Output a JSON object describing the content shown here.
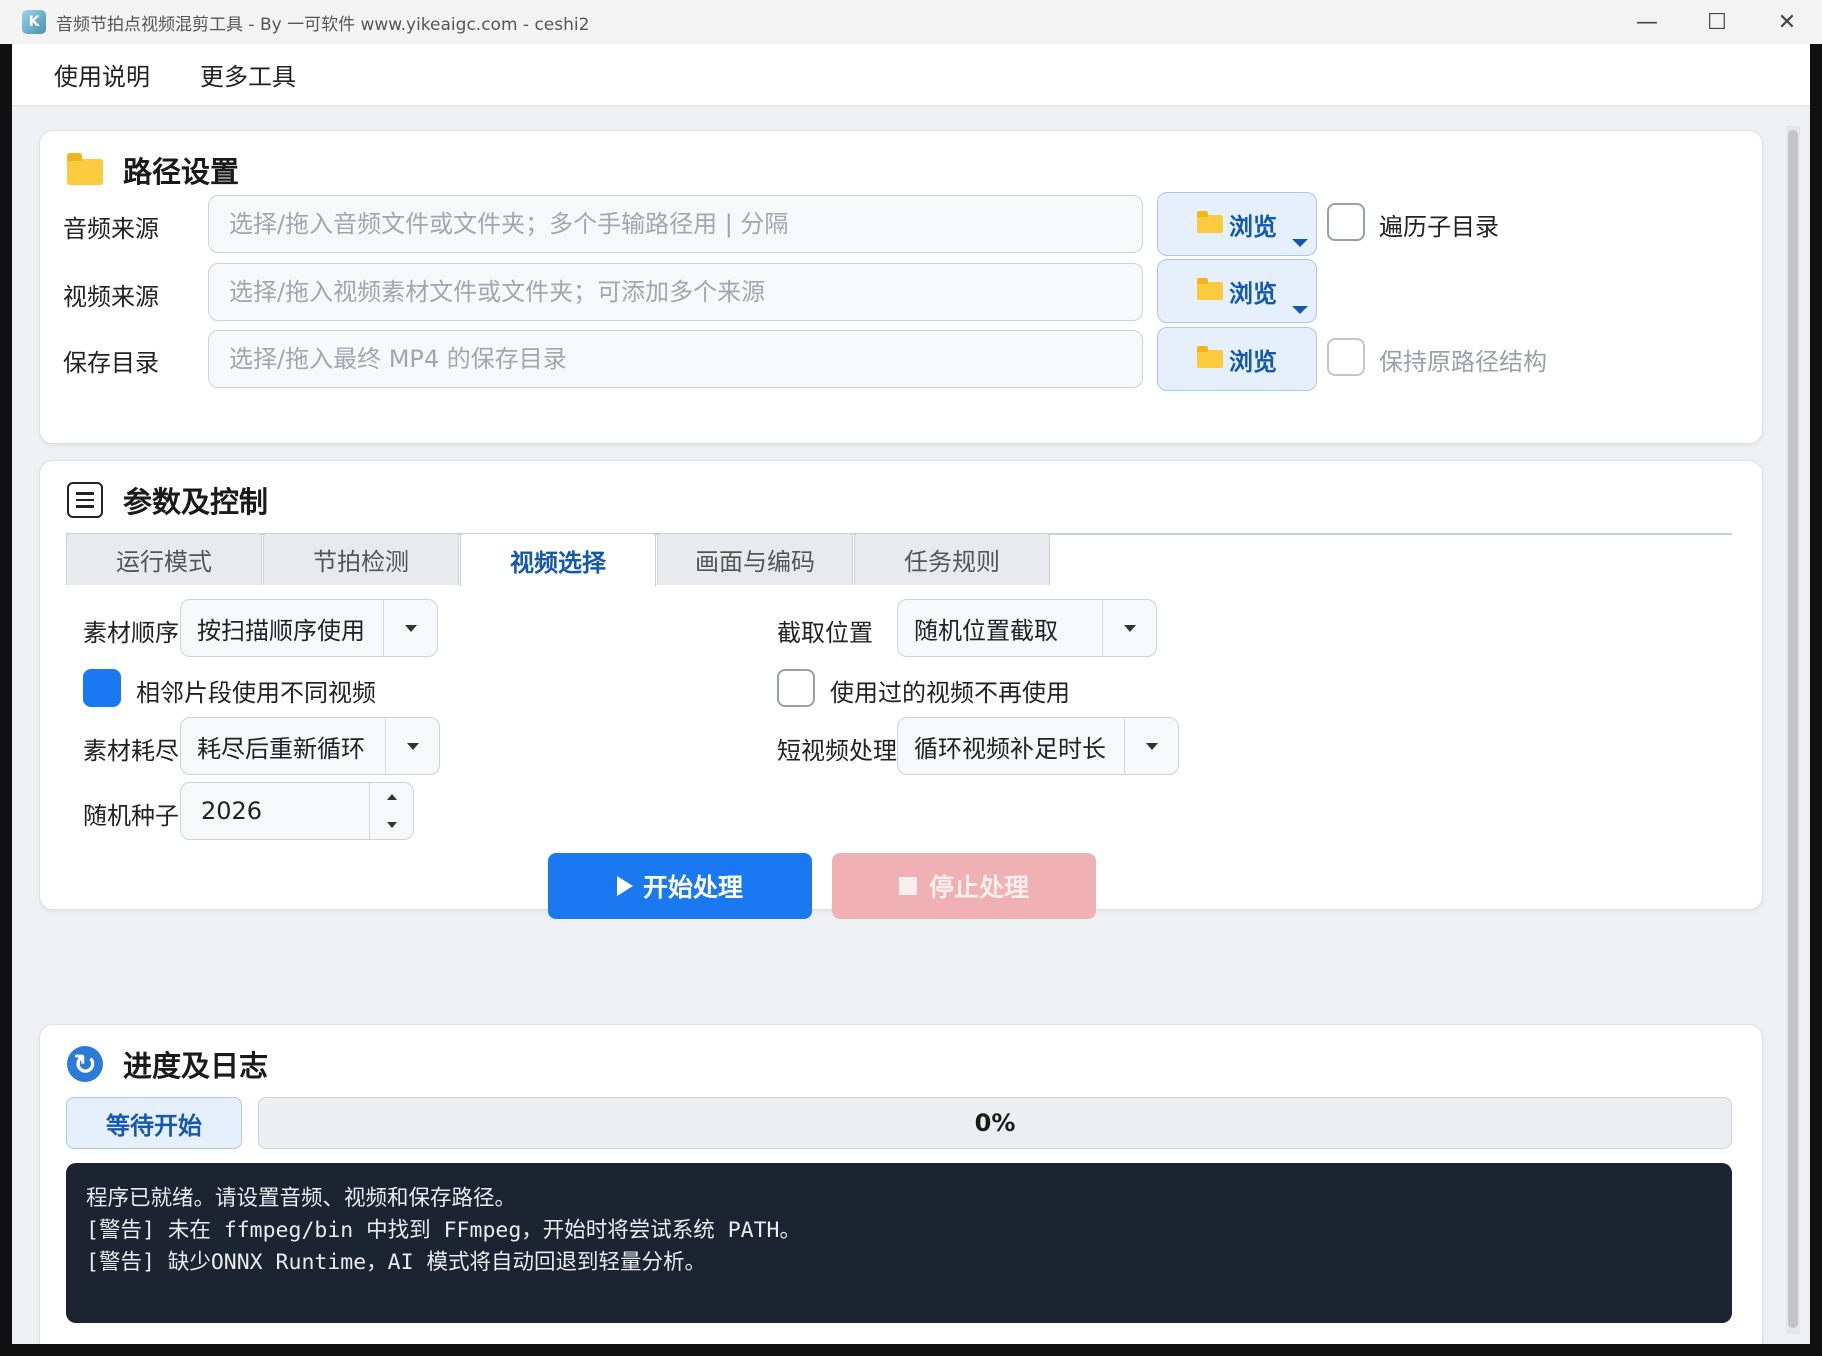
{
  "window": {
    "title": "音频节拍点视频混剪工具 - By 一可软件 www.yikeaigc.com - ceshi2",
    "app_icon_glyph": "K",
    "minimize_glyph": "—",
    "maximize_glyph": "☐",
    "close_glyph": "✕"
  },
  "menu": {
    "items": [
      "使用说明",
      "更多工具"
    ]
  },
  "path_settings": {
    "title": "路径设置",
    "browse_label": "浏览",
    "rows": [
      {
        "label": "音频来源",
        "placeholder": "选择/拖入音频文件或文件夹；多个手输路径用 | 分隔",
        "value": ""
      },
      {
        "label": "视频来源",
        "placeholder": "选择/拖入视频素材文件或文件夹；可添加多个来源",
        "value": ""
      },
      {
        "label": "保存目录",
        "placeholder": "选择/拖入最终 MP4 的保存目录",
        "value": ""
      }
    ],
    "recurse_label": "遍历子目录",
    "recurse_checked": false,
    "keep_structure_label": "保持原路径结构",
    "keep_structure_checked": false
  },
  "params": {
    "title": "参数及控制",
    "tabs": [
      "运行模式",
      "节拍检测",
      "视频选择",
      "画面与编码",
      "任务规则"
    ],
    "active_tab": 2,
    "material_order_label": "素材顺序",
    "material_order_value": "按扫描顺序使用",
    "clip_position_label": "截取位置",
    "clip_position_value": "随机位置截取",
    "adjacent_diff_label": "相邻片段使用不同视频",
    "adjacent_diff_checked": true,
    "no_reuse_label": "使用过的视频不再使用",
    "no_reuse_checked": false,
    "exhausted_label": "素材耗尽",
    "exhausted_value": "耗尽后重新循环",
    "short_video_label": "短视频处理",
    "short_video_value": "循环视频补足时长",
    "seed_label": "随机种子",
    "seed_value": "2026",
    "start_button": "开始处理",
    "stop_button": "停止处理"
  },
  "progress": {
    "title": "进度及日志",
    "status": "等待开始",
    "percent": 0,
    "percent_text": "0%",
    "log_lines": [
      "程序已就绪。请设置音频、视频和保存路径。",
      "[警告] 未在 ffmpeg/bin 中找到 FFmpeg，开始时将尝试系统 PATH。",
      "[警告] 缺少ONNX Runtime，AI 模式将自动回退到轻量分析。"
    ]
  },
  "colors": {
    "accent": "#1a78f0",
    "stop": "#efb1b3",
    "log_bg": "#1b2430"
  }
}
